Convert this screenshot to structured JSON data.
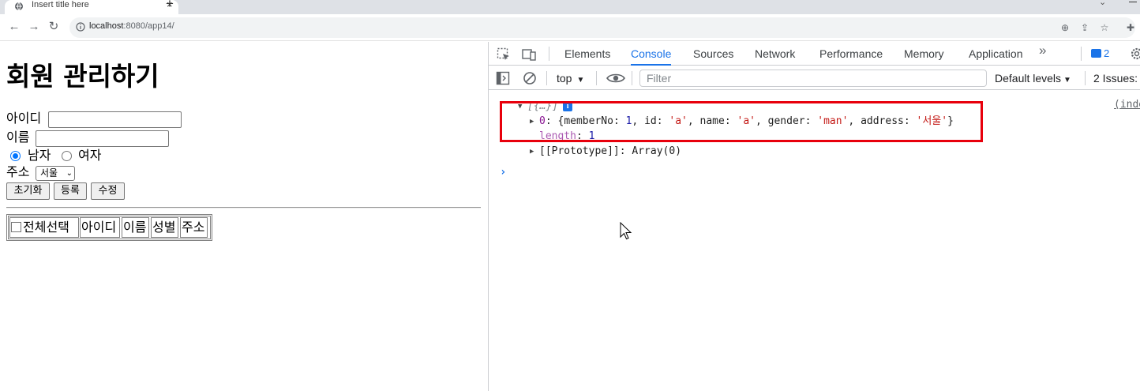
{
  "browser": {
    "tab_title": "Insert title here",
    "new_tab": "+",
    "tab_close": "×",
    "url_host": "localhost",
    "url_rest": ":8080/app14/"
  },
  "page": {
    "title": "회원 관리하기",
    "id_label": "아이디",
    "name_label": "이름",
    "gender_male": "남자",
    "gender_female": "여자",
    "selected_gender": "남자",
    "address_label": "주소",
    "address_selected": "서울",
    "buttons": {
      "reset": "초기화",
      "register": "등록",
      "edit": "수정"
    },
    "table_headers": [
      "전체선택",
      "아이디",
      "이름",
      "성별",
      "주소"
    ]
  },
  "devtools": {
    "tabs": [
      "Elements",
      "Console",
      "Sources",
      "Network",
      "Performance",
      "Memory",
      "Application"
    ],
    "active_tab": "Console",
    "more": "»",
    "message_count": "2",
    "context": "top",
    "filter_placeholder": "Filter",
    "levels": "Default levels",
    "issues": "2 Issues:",
    "source_link": "(inde",
    "log": {
      "header": "[{…}]",
      "info": "i",
      "item_index": "0",
      "member_no_key": "memberNo",
      "member_no": "1",
      "id_key": "id",
      "id_val": "'a'",
      "name_key": "name",
      "name_val": "'a'",
      "gender_key": "gender",
      "gender_val": "'man'",
      "address_key": "address",
      "address_val": "'서울'",
      "length_key": "length",
      "length_val": "1",
      "prototype_key": "[[Prototype]]",
      "prototype_val": "Array(0)"
    },
    "prompt": "›"
  },
  "colors": {
    "accent": "#1a73e8",
    "highlight_box": "#e8000c",
    "string": "#c41a16",
    "key": "#881391"
  }
}
